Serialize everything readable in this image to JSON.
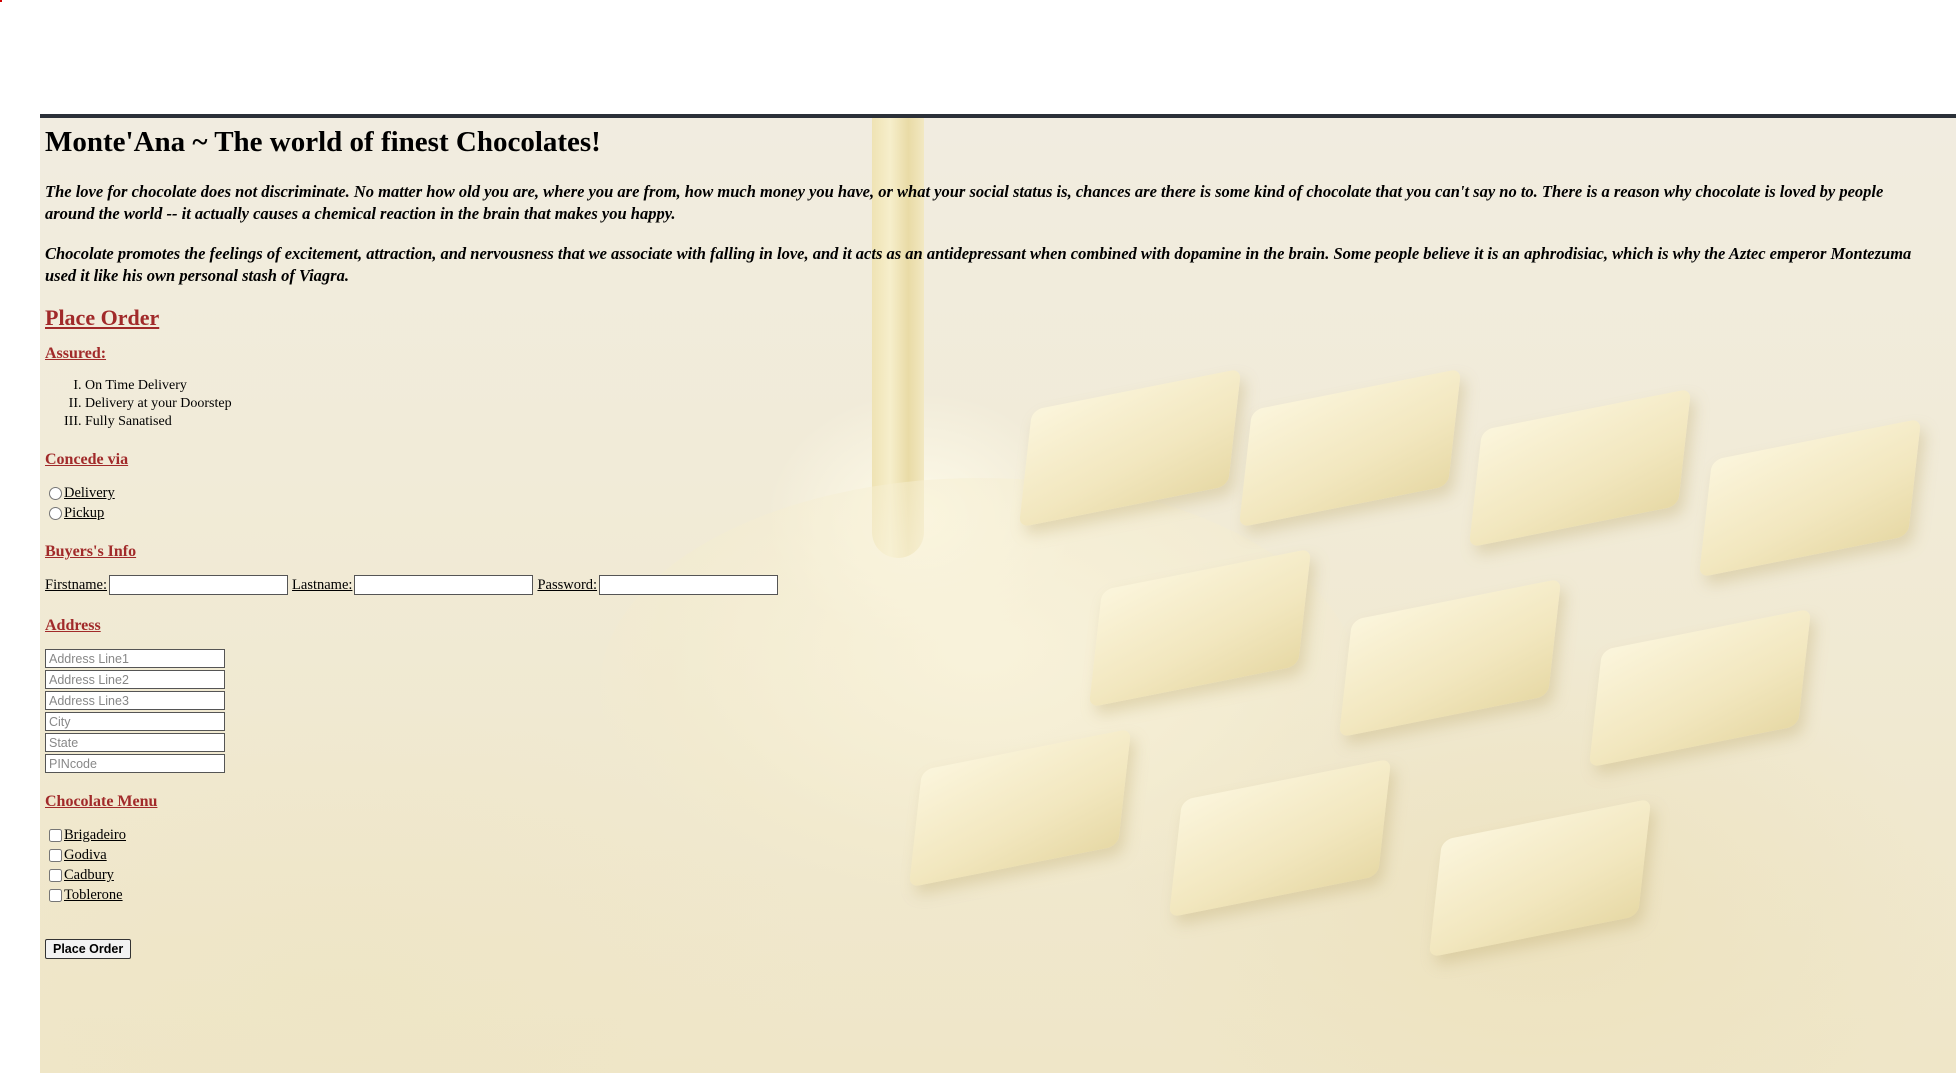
{
  "title": "Monte'Ana ~ The world of finest Chocolates!",
  "intro": [
    "The love for chocolate does not discriminate. No matter how old you are, where you are from, how much money you have, or what your social status is, chances are there is some kind of chocolate that you can't say no to. There is a reason why chocolate is loved by people around the world -- it actually causes a chemical reaction in the brain that makes you happy.",
    "Chocolate promotes the feelings of excitement, attraction, and nervousness that we associate with falling in love, and it acts as an antidepressant when combined with dopamine in the brain. Some people believe it is an aphrodisiac, which is why the Aztec emperor Montezuma used it like his own personal stash of Viagra."
  ],
  "order_heading": "Place Order",
  "assured": {
    "heading": "Assured:",
    "items": [
      "On Time Delivery",
      "Delivery at your Doorstep",
      "Fully Sanatised"
    ]
  },
  "concede": {
    "heading": "Concede via",
    "options": [
      "Delivery",
      "Pickup"
    ]
  },
  "buyers": {
    "heading": "Buyers's Info",
    "firstname_label": "Firstname:",
    "lastname_label": "Lastname:",
    "password_label": "Password:"
  },
  "address": {
    "heading": "Address",
    "placeholders": [
      "Address Line1",
      "Address Line2",
      "Address Line3",
      "City",
      "State",
      "PINcode"
    ]
  },
  "menu": {
    "heading": "Chocolate Menu",
    "items": [
      "Brigadeiro",
      "Godiva",
      "Cadbury",
      "Toblerone"
    ]
  },
  "submit_label": "Place Order"
}
